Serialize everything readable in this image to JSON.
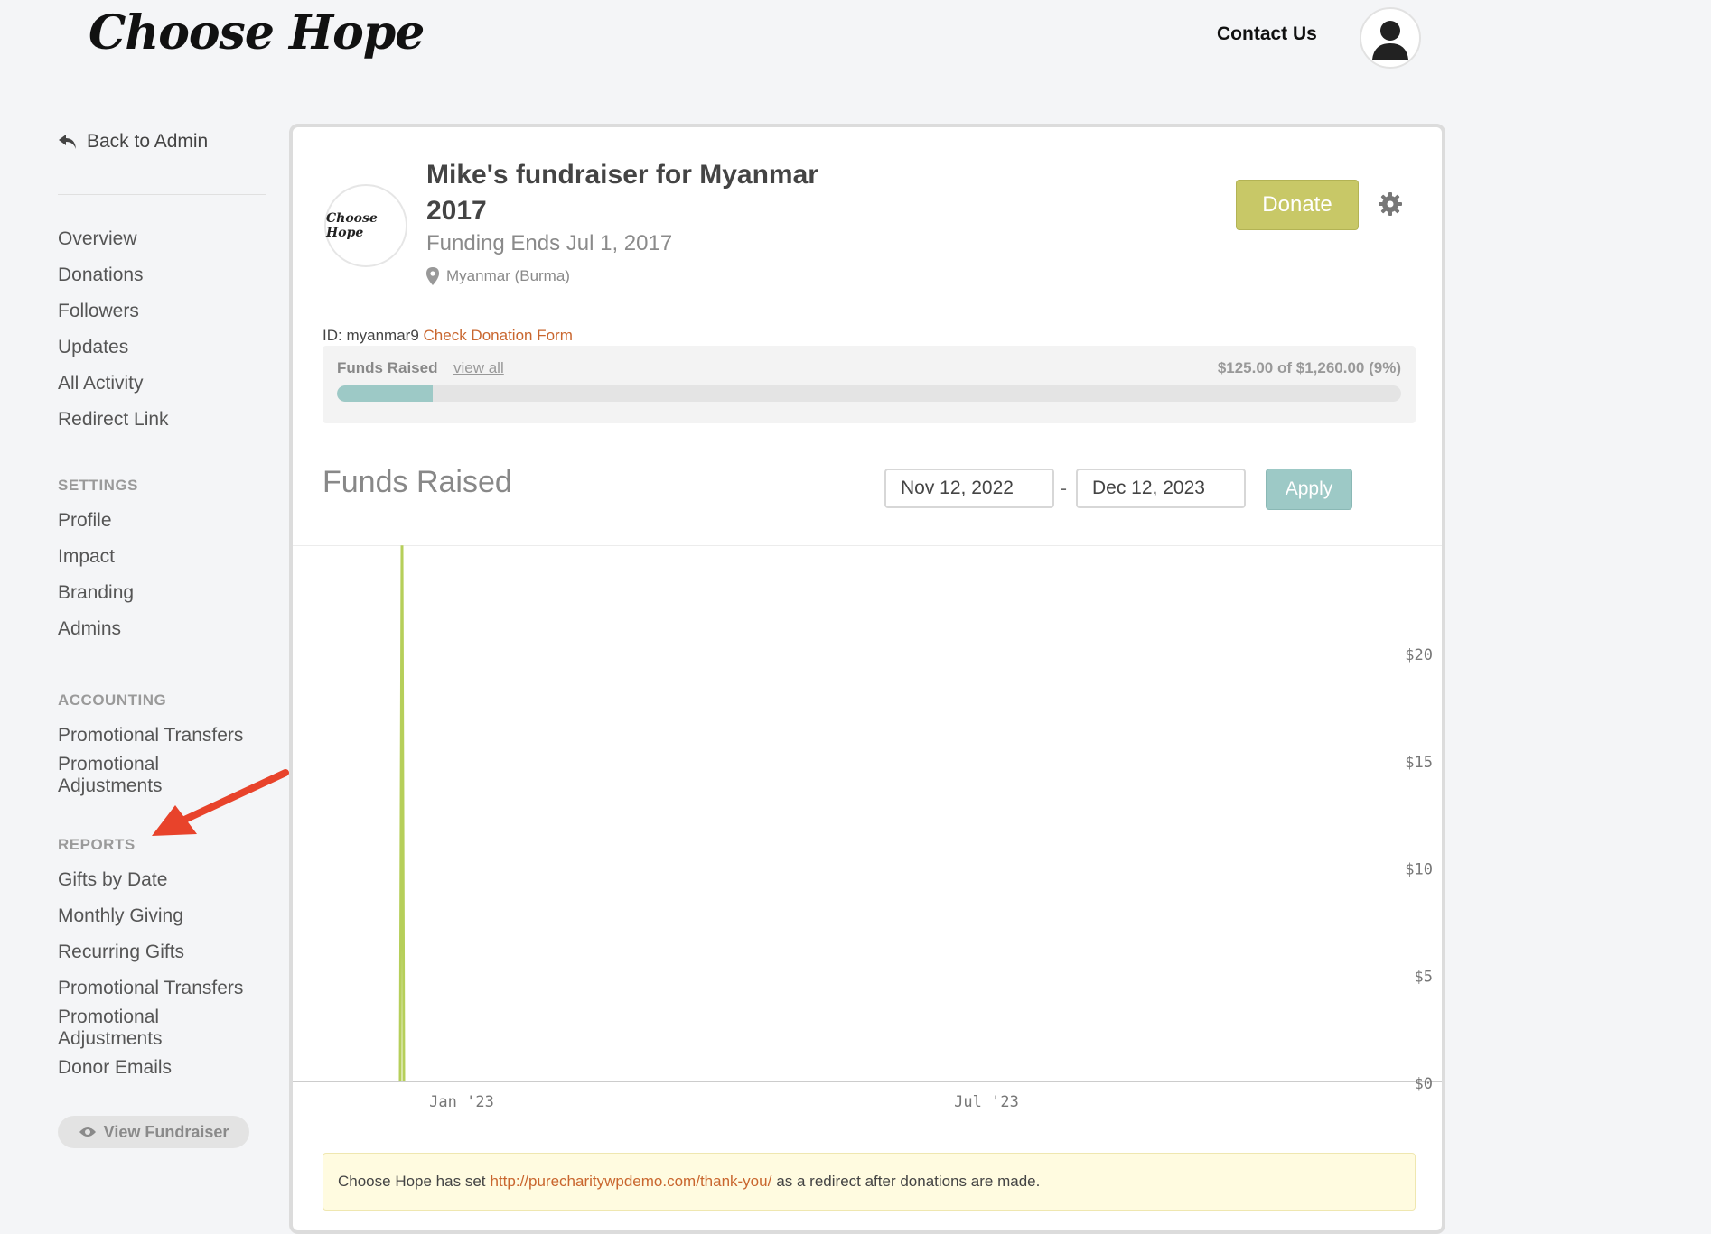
{
  "header": {
    "logo": "Choose Hope",
    "contact": "Contact Us"
  },
  "sidebar": {
    "back": "Back to Admin",
    "main_items": [
      "Overview",
      "Donations",
      "Followers",
      "Updates",
      "All Activity",
      "Redirect Link"
    ],
    "settings_heading": "SETTINGS",
    "settings_items": [
      "Profile",
      "Impact",
      "Branding",
      "Admins"
    ],
    "accounting_heading": "ACCOUNTING",
    "accounting_items": [
      "Promotional Transfers",
      "Promotional Adjustments"
    ],
    "reports_heading": "REPORTS",
    "reports_items": [
      "Gifts by Date",
      "Monthly Giving",
      "Recurring Gifts",
      "Promotional Transfers",
      "Promotional Adjustments",
      "Donor Emails"
    ],
    "view_fundraiser": "View Fundraiser"
  },
  "fundraiser": {
    "org_logo": "Choose Hope",
    "title": "Mike's fundraiser for Myanmar 2017",
    "funding_ends": "Funding Ends Jul 1, 2017",
    "location": "Myanmar (Burma)",
    "donate_label": "Donate",
    "id_label": "ID:",
    "id_value": "myanmar9",
    "check_form": "Check Donation Form"
  },
  "funds": {
    "label": "Funds Raised",
    "view_all": "view all",
    "amount_text": "$125.00 of $1,260.00 (9%)",
    "progress_fraction": 0.09
  },
  "filter": {
    "heading": "Funds Raised",
    "start": "Nov 12, 2022",
    "separator": "-",
    "end": "Dec 12, 2023",
    "apply": "Apply"
  },
  "chart_data": {
    "type": "line",
    "x_tick_labels": [
      "Jan '23",
      "Jul '23"
    ],
    "y_tick_labels": [
      "$20",
      "$15",
      "$10",
      "$5",
      "$0"
    ],
    "ylim": [
      0,
      20
    ],
    "series": [
      {
        "values": [
          0,
          25,
          0
        ],
        "color": "#b6cf5a"
      }
    ],
    "line_color": "#b6cf5a"
  },
  "notice": {
    "prefix": "Choose Hope has set",
    "url": "http://purecharitywpdemo.com/thank-you/",
    "suffix": "as a redirect after donations are made."
  },
  "colors": {
    "accent": "#c8c867",
    "teal": "#9dc9c6",
    "link": "#c9662e",
    "arrow": "#e8432b"
  }
}
